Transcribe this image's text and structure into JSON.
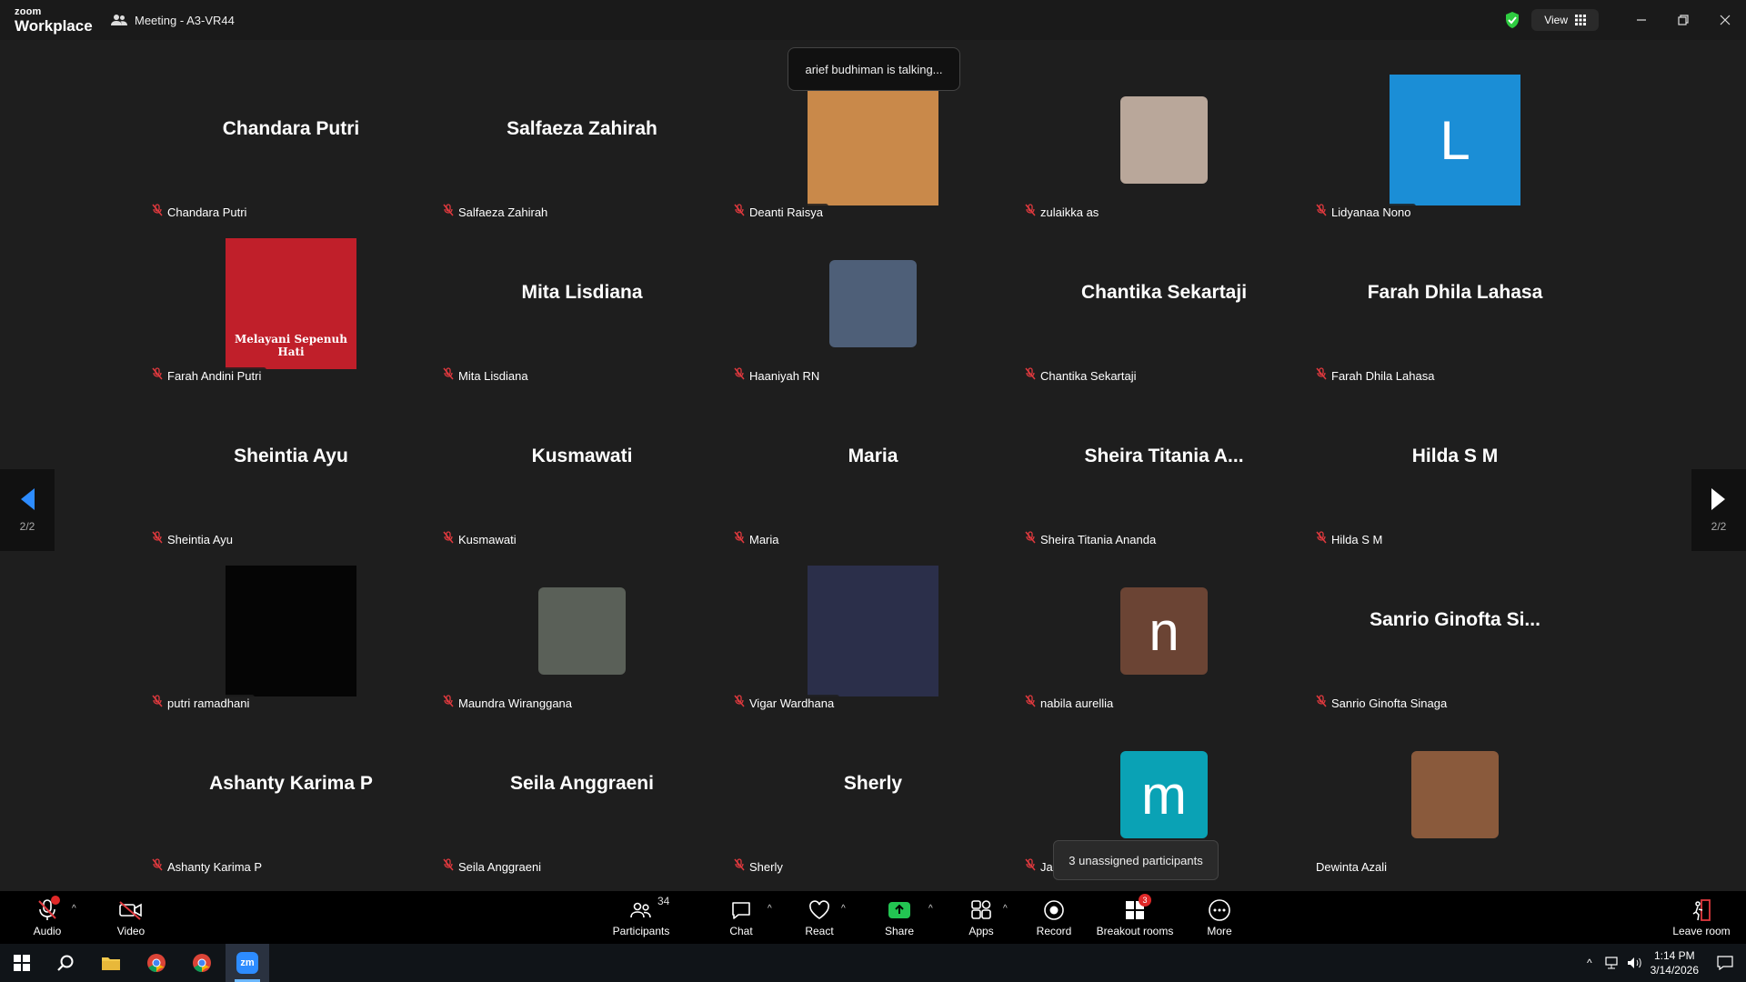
{
  "window": {
    "logo_line1": "zoom",
    "logo_line2": "Workplace",
    "meeting_title": "Meeting - A3-VR44",
    "view_label": "View"
  },
  "speaker_banner": "arief budhiman is talking...",
  "pager": {
    "left_label": "2/2",
    "right_label": "2/2"
  },
  "tooltip": "3 unassigned participants",
  "participants": [
    {
      "name": "Chandara Putri",
      "display": "Chandara Putri",
      "type": "name",
      "muted": true
    },
    {
      "name": "Salfaeza Zahirah",
      "display": "Salfaeza Zahirah",
      "type": "name",
      "muted": true
    },
    {
      "name": "Deanti Raisya",
      "type": "photo",
      "size": "big",
      "color": "#c9894a",
      "muted": true
    },
    {
      "name": "zulaikka as",
      "type": "photo",
      "size": "small",
      "color": "#b9a79a",
      "muted": true
    },
    {
      "name": "Lidyanaa Nono",
      "type": "letter",
      "letter": "L",
      "size": "big",
      "color": "#1b8ed6",
      "muted": true
    },
    {
      "name": "Farah Andini Putri",
      "type": "photo",
      "size": "big",
      "color": "#c01f2a",
      "caption": "Melayani Sepenuh Hati",
      "muted": true
    },
    {
      "name": "Mita Lisdiana",
      "display": "Mita Lisdiana",
      "type": "name",
      "muted": true
    },
    {
      "name": "Haaniyah RN",
      "type": "photo",
      "size": "small",
      "color": "#4e5f78",
      "muted": true
    },
    {
      "name": "Chantika Sekartaji",
      "display": "Chantika Sekartaji",
      "type": "name",
      "muted": true
    },
    {
      "name": "Farah Dhila Lahasa",
      "display": "Farah Dhila Lahasa",
      "type": "name",
      "muted": true
    },
    {
      "name": "Sheintia Ayu",
      "display": "Sheintia Ayu",
      "type": "name",
      "muted": true
    },
    {
      "name": "Kusmawati",
      "display": "Kusmawati",
      "type": "name",
      "muted": true
    },
    {
      "name": "Maria",
      "display": "Maria",
      "type": "name",
      "muted": true
    },
    {
      "name": "Sheira Titania Ananda",
      "display": "Sheira Titania A...",
      "type": "name",
      "muted": true
    },
    {
      "name": "Hilda S M",
      "display": "Hilda S M",
      "type": "name",
      "muted": true
    },
    {
      "name": "putri ramadhani",
      "type": "photo",
      "size": "big",
      "color": "#050505",
      "muted": true
    },
    {
      "name": "Maundra Wiranggana",
      "type": "photo",
      "size": "small",
      "color": "#5a6058",
      "muted": true
    },
    {
      "name": "Vigar Wardhana",
      "type": "photo",
      "size": "big",
      "color": "#2b2f4a",
      "muted": true
    },
    {
      "name": "nabila aurellia",
      "type": "letter",
      "letter": "n",
      "size": "small",
      "color": "#6b4434",
      "muted": true
    },
    {
      "name": "Sanrio Ginofta Sinaga",
      "display": "Sanrio Ginofta Si...",
      "type": "name",
      "muted": true
    },
    {
      "name": "Ashanty Karima P",
      "display": "Ashanty Karima P",
      "type": "name",
      "muted": true
    },
    {
      "name": "Seila Anggraeni",
      "display": "Seila Anggraeni",
      "type": "name",
      "muted": true
    },
    {
      "name": "Sherly",
      "display": "Sherly",
      "type": "name",
      "muted": true
    },
    {
      "name": "Jas",
      "type": "letter",
      "letter": "m",
      "size": "small",
      "color": "#0aa2b5",
      "muted": true
    },
    {
      "name": "Dewinta Azali",
      "type": "photo",
      "size": "small",
      "color": "#8a5a3c",
      "muted": false
    }
  ],
  "toolbar": {
    "audio": "Audio",
    "video": "Video",
    "participants": "Participants",
    "participant_count": "34",
    "chat": "Chat",
    "react": "React",
    "share": "Share",
    "apps": "Apps",
    "record": "Record",
    "breakout": "Breakout rooms",
    "breakout_badge": "3",
    "more": "More",
    "leave": "Leave room"
  },
  "taskbar": {
    "time": "1:14 PM",
    "date": "3/14/2026",
    "zoom_glyph": "zm"
  },
  "colors": {
    "share_green": "#23c552",
    "shield_green": "#2ecc40",
    "pager_blue": "#2d8cff",
    "mute_red": "#e0393e"
  }
}
